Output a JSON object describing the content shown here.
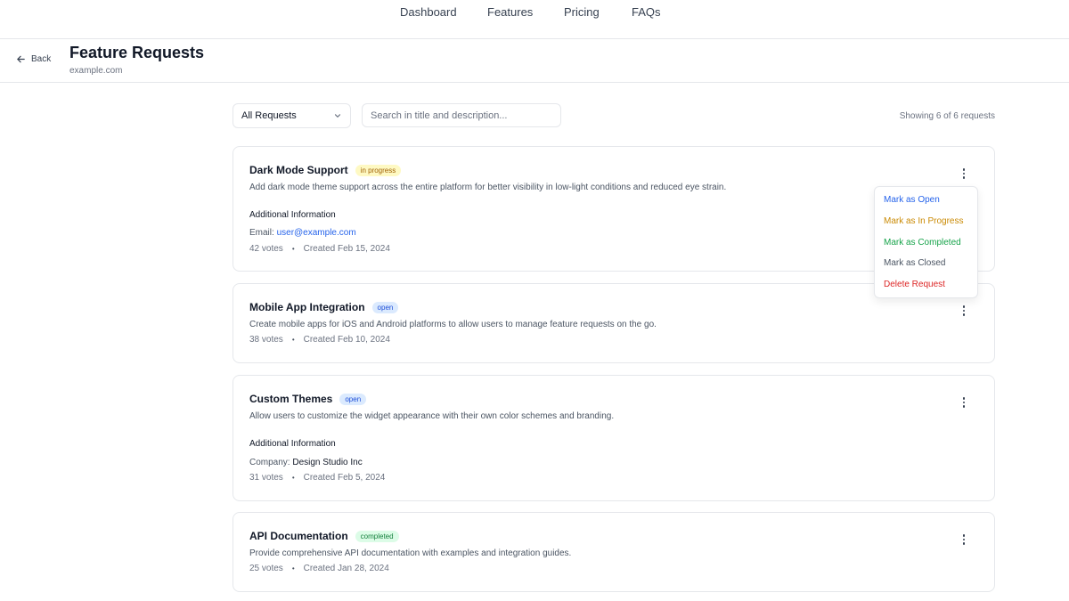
{
  "nav": {
    "links": [
      "Dashboard",
      "Features",
      "Pricing",
      "FAQs"
    ]
  },
  "header": {
    "back_label": "Back",
    "title": "Feature Requests",
    "subtitle": "example.com"
  },
  "toolbar": {
    "filter_value": "All Requests",
    "search_placeholder": "Search in title and description...",
    "showing_text": "Showing 6 of 6 requests"
  },
  "requests": [
    {
      "title": "Dark Mode Support",
      "status": "in progress",
      "description": "Add dark mode theme support across the entire platform for better visibility in low-light conditions and reduced eye strain.",
      "additional_heading": "Additional Information",
      "info_label": "Email:",
      "info_value": "user@example.com",
      "votes": "42 votes",
      "created": "Created Feb 15, 2024"
    },
    {
      "title": "Mobile App Integration",
      "status": "open",
      "description": "Create mobile apps for iOS and Android platforms to allow users to manage feature requests on the go.",
      "votes": "38 votes",
      "created": "Created Feb 10, 2024"
    },
    {
      "title": "Custom Themes",
      "status": "open",
      "description": "Allow users to customize the widget appearance with their own color schemes and branding.",
      "additional_heading": "Additional Information",
      "info_label": "Company:",
      "info_value": "Design Studio Inc",
      "votes": "31 votes",
      "created": "Created Feb 5, 2024"
    },
    {
      "title": "API Documentation",
      "status": "completed",
      "description": "Provide comprehensive API documentation with examples and integration guides.",
      "votes": "25 votes",
      "created": "Created Jan 28, 2024"
    }
  ],
  "context_menu": {
    "items": [
      {
        "label": "Mark as Open",
        "color": "#2563eb"
      },
      {
        "label": "Mark as In Progress",
        "color": "#ca8a04"
      },
      {
        "label": "Mark as Completed",
        "color": "#16a34a"
      },
      {
        "label": "Mark as Closed",
        "color": "#4b5563"
      },
      {
        "label": "Delete Request",
        "color": "#dc2626"
      }
    ]
  },
  "meta_separator": "•"
}
